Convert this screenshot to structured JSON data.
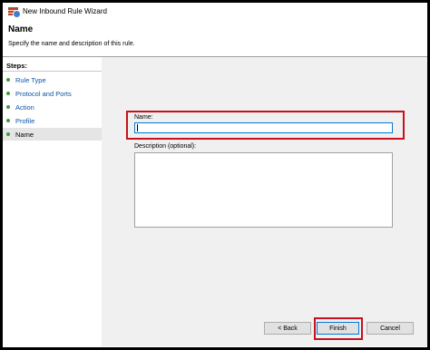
{
  "window": {
    "title": "New Inbound Rule Wizard",
    "icon": "firewall-icon"
  },
  "header": {
    "title": "Name",
    "subtitle": "Specify the name and description of this rule."
  },
  "steps": {
    "heading": "Steps:",
    "items": [
      {
        "label": "Rule Type",
        "status": "complete"
      },
      {
        "label": "Protocol and Ports",
        "status": "complete"
      },
      {
        "label": "Action",
        "status": "complete"
      },
      {
        "label": "Profile",
        "status": "complete"
      },
      {
        "label": "Name",
        "status": "current"
      }
    ]
  },
  "form": {
    "name_label": "Name:",
    "name_value": "",
    "description_label": "Description (optional):",
    "description_value": ""
  },
  "buttons": {
    "back": "< Back",
    "finish": "Finish",
    "cancel": "Cancel"
  },
  "colors": {
    "highlight": "#c8101e",
    "step_dot": "#3c9a3c",
    "step_link": "#0b55a8"
  }
}
